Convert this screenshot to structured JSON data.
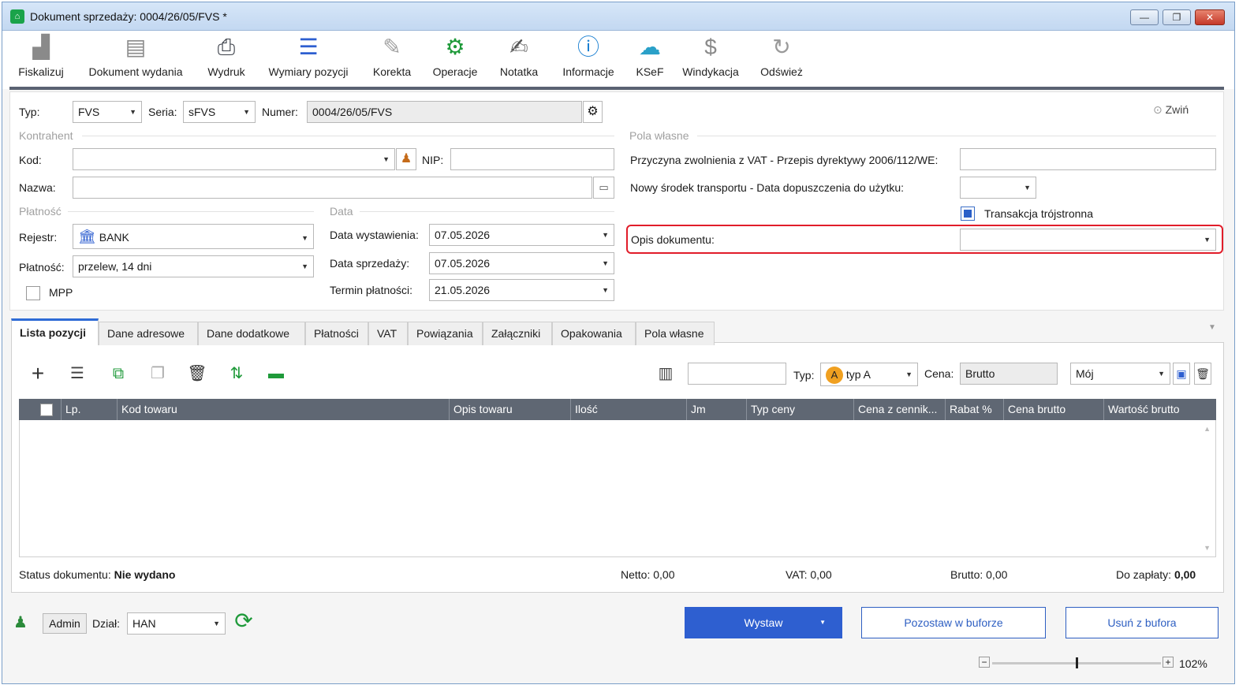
{
  "window": {
    "title": "Dokument sprzedaży: 0004/26/05/FVS *",
    "minimize": "—",
    "maximize": "❐",
    "close": "✕"
  },
  "toolbar": {
    "fiskalizuj": "Fiskalizuj",
    "dokument_wydania": "Dokument wydania",
    "wydruk": "Wydruk",
    "wymiary_pozycji": "Wymiary pozycji",
    "korekta": "Korekta",
    "operacje": "Operacje",
    "notatka": "Notatka",
    "informacje": "Informacje",
    "ksef": "KSeF",
    "windykacja": "Windykacja",
    "odswiez": "Odśwież"
  },
  "header": {
    "typ_label": "Typ:",
    "typ_value": "FVS",
    "seria_label": "Seria:",
    "seria_value": "sFVS",
    "numer_label": "Numer:",
    "numer_value": "0004/26/05/FVS",
    "collapse_label": "Zwiń"
  },
  "kontrahent": {
    "group": "Kontrahent",
    "kod_label": "Kod:",
    "kod_value": "",
    "nip_label": "NIP:",
    "nip_value": "",
    "nazwa_label": "Nazwa:",
    "nazwa_value": ""
  },
  "platnosc": {
    "group": "Płatność",
    "rejestr_label": "Rejestr:",
    "rejestr_value": "BANK",
    "platnosc_label": "Płatność:",
    "platnosc_value": "przelew, 14 dni",
    "mpp_label": "MPP",
    "mpp_checked": false
  },
  "data": {
    "group": "Data",
    "wystawienia_label": "Data wystawienia:",
    "wystawienia_value": "07.05.2026",
    "sprzedazy_label": "Data sprzedaży:",
    "sprzedazy_value": "07.05.2026",
    "termin_label": "Termin płatności:",
    "termin_value": "21.05.2026"
  },
  "pola_wlasne": {
    "group": "Pola własne",
    "przyczyna_label": "Przyczyna zwolnienia z VAT - Przepis dyrektywy 2006/112/WE:",
    "przyczyna_value": "",
    "transport_label": "Nowy środek transportu - Data dopuszczenia do użytku:",
    "transport_value": "",
    "trojstronna_label": "Transakcja trójstronna",
    "trojstronna_checked": true,
    "opis_label": "Opis dokumentu:",
    "opis_value": ""
  },
  "tabs": [
    "Lista pozycji",
    "Dane adresowe",
    "Dane dodatkowe",
    "Płatności",
    "VAT",
    "Powiązania",
    "Załączniki",
    "Opakowania",
    "Pola własne"
  ],
  "positions_toolbar": {
    "search_value": "",
    "typ_label": "Typ:",
    "typ_badge": "A",
    "typ_value": "typ A",
    "cena_label": "Cena:",
    "cena_value": "Brutto",
    "profile_value": "Mój"
  },
  "grid": {
    "columns": [
      "Lp.",
      "Kod towaru",
      "Opis towaru",
      "Ilość",
      "Jm",
      "Typ ceny",
      "Cena z cennik...",
      "Rabat %",
      "Cena brutto",
      "Wartość brutto"
    ],
    "rows": []
  },
  "summary": {
    "status_label": "Status dokumentu:",
    "status_value": "Nie wydano",
    "netto_label": "Netto:",
    "netto_value": "0,00",
    "vat_label": "VAT:",
    "vat_value": "0,00",
    "brutto_label": "Brutto:",
    "brutto_value": "0,00",
    "dozaplaty_label": "Do zapłaty:",
    "dozaplaty_value": "0,00"
  },
  "footer": {
    "user": "Admin",
    "dzial_label": "Dział:",
    "dzial_value": "HAN",
    "wystaw": "Wystaw",
    "pozostaw": "Pozostaw w buforze",
    "usun": "Usuń z bufora",
    "zoom": "102%"
  },
  "colors": {
    "accent": "#2e5fd0",
    "highlight": "#e11d2a",
    "grid_header": "#5f6773"
  }
}
